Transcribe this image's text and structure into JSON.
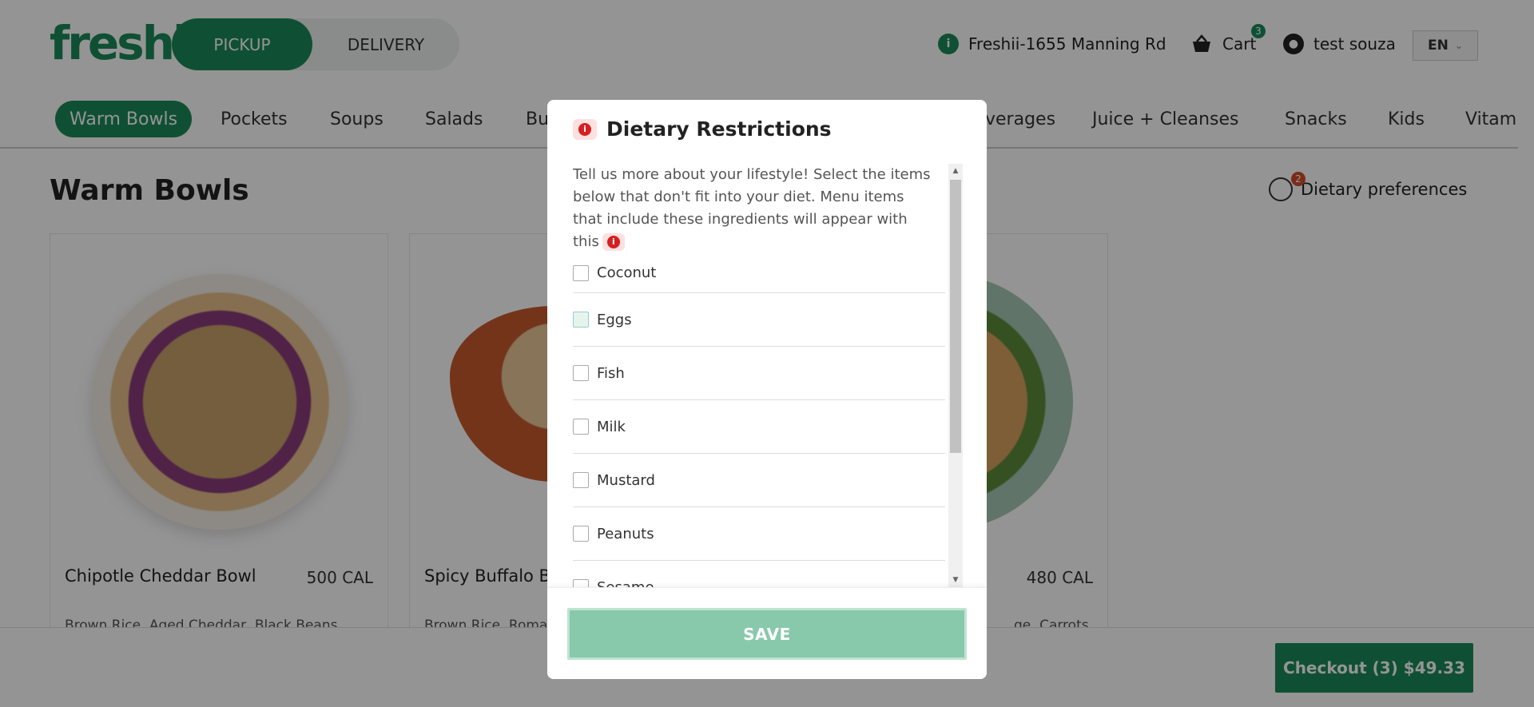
{
  "brand": {
    "logo_text": "freshii",
    "accent": "#1b8a5a"
  },
  "header": {
    "pickup_label": "PICKUP",
    "delivery_label": "DELIVERY",
    "location_label": "Freshii-1655 Manning Rd",
    "cart_label": "Cart",
    "cart_count": "3",
    "user_name": "test souza",
    "language": "EN"
  },
  "categories": [
    {
      "label": "Warm Bowls",
      "active": true
    },
    {
      "label": "Pockets"
    },
    {
      "label": "Soups"
    },
    {
      "label": "Salads"
    },
    {
      "label": "Bu"
    },
    {
      "label": "verages"
    },
    {
      "label": "Juice + Cleanses"
    },
    {
      "label": "Snacks"
    },
    {
      "label": "Kids"
    },
    {
      "label": "Vitam"
    }
  ],
  "main": {
    "section_title": "Warm Bowls",
    "dietary_preferences_label": "Dietary preferences",
    "dietary_preferences_count": "2",
    "cards": [
      {
        "name": "Chipotle Cheddar Bowl",
        "calories": "500 CAL",
        "description": "Brown Rice, Aged Cheddar, Black Beans,"
      },
      {
        "name": "Spicy Buffalo Bo",
        "calories": "",
        "description": "Brown Rice, Roma"
      },
      {
        "name": "",
        "calories": "480 CAL",
        "description": "ge, Carrots,"
      }
    ]
  },
  "checkout": {
    "label": "Checkout (3) $49.33"
  },
  "modal": {
    "title": "Dietary Restrictions",
    "intro": "Tell us more about your lifestyle! Select the items below that don't fit into your diet. Menu items that include these ingredients will appear with this",
    "options": [
      {
        "label": "Coconut"
      },
      {
        "label": "Eggs"
      },
      {
        "label": "Fish"
      },
      {
        "label": "Milk"
      },
      {
        "label": "Mustard"
      },
      {
        "label": "Peanuts"
      },
      {
        "label": "Sesame"
      }
    ],
    "save_label": "SAVE"
  }
}
